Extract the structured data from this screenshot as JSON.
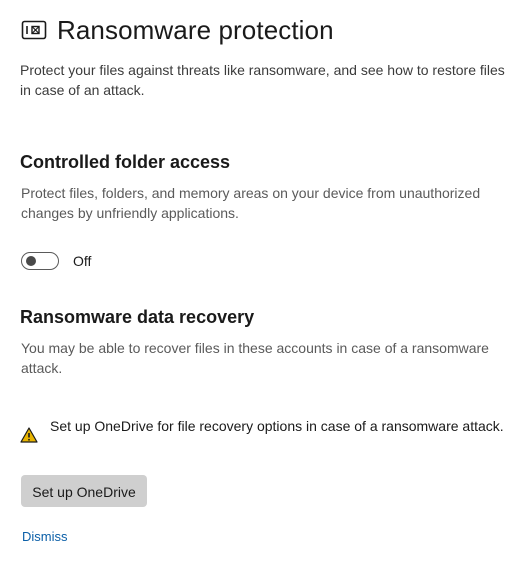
{
  "header": {
    "title": "Ransomware protection",
    "icon": "ransomware-shield-icon",
    "description": "Protect your files against threats like ransomware, and see how to restore files in case of an attack."
  },
  "controlled_folder_access": {
    "title": "Controlled folder access",
    "description": "Protect files, folders, and memory areas on your device from unauthorized changes by unfriendly applications.",
    "toggle_state": "Off"
  },
  "data_recovery": {
    "title": "Ransomware data recovery",
    "description": "You may be able to recover files in these accounts in case of a ransomware attack.",
    "warning_text": "Set up OneDrive for file recovery options in case of a ransomware attack.",
    "warning_icon": "warning-icon",
    "button_label": "Set up OneDrive",
    "dismiss_label": "Dismiss"
  },
  "colors": {
    "link": "#0b5fa8",
    "button_bg": "#cfcfcf",
    "warning": "#e8b400"
  }
}
